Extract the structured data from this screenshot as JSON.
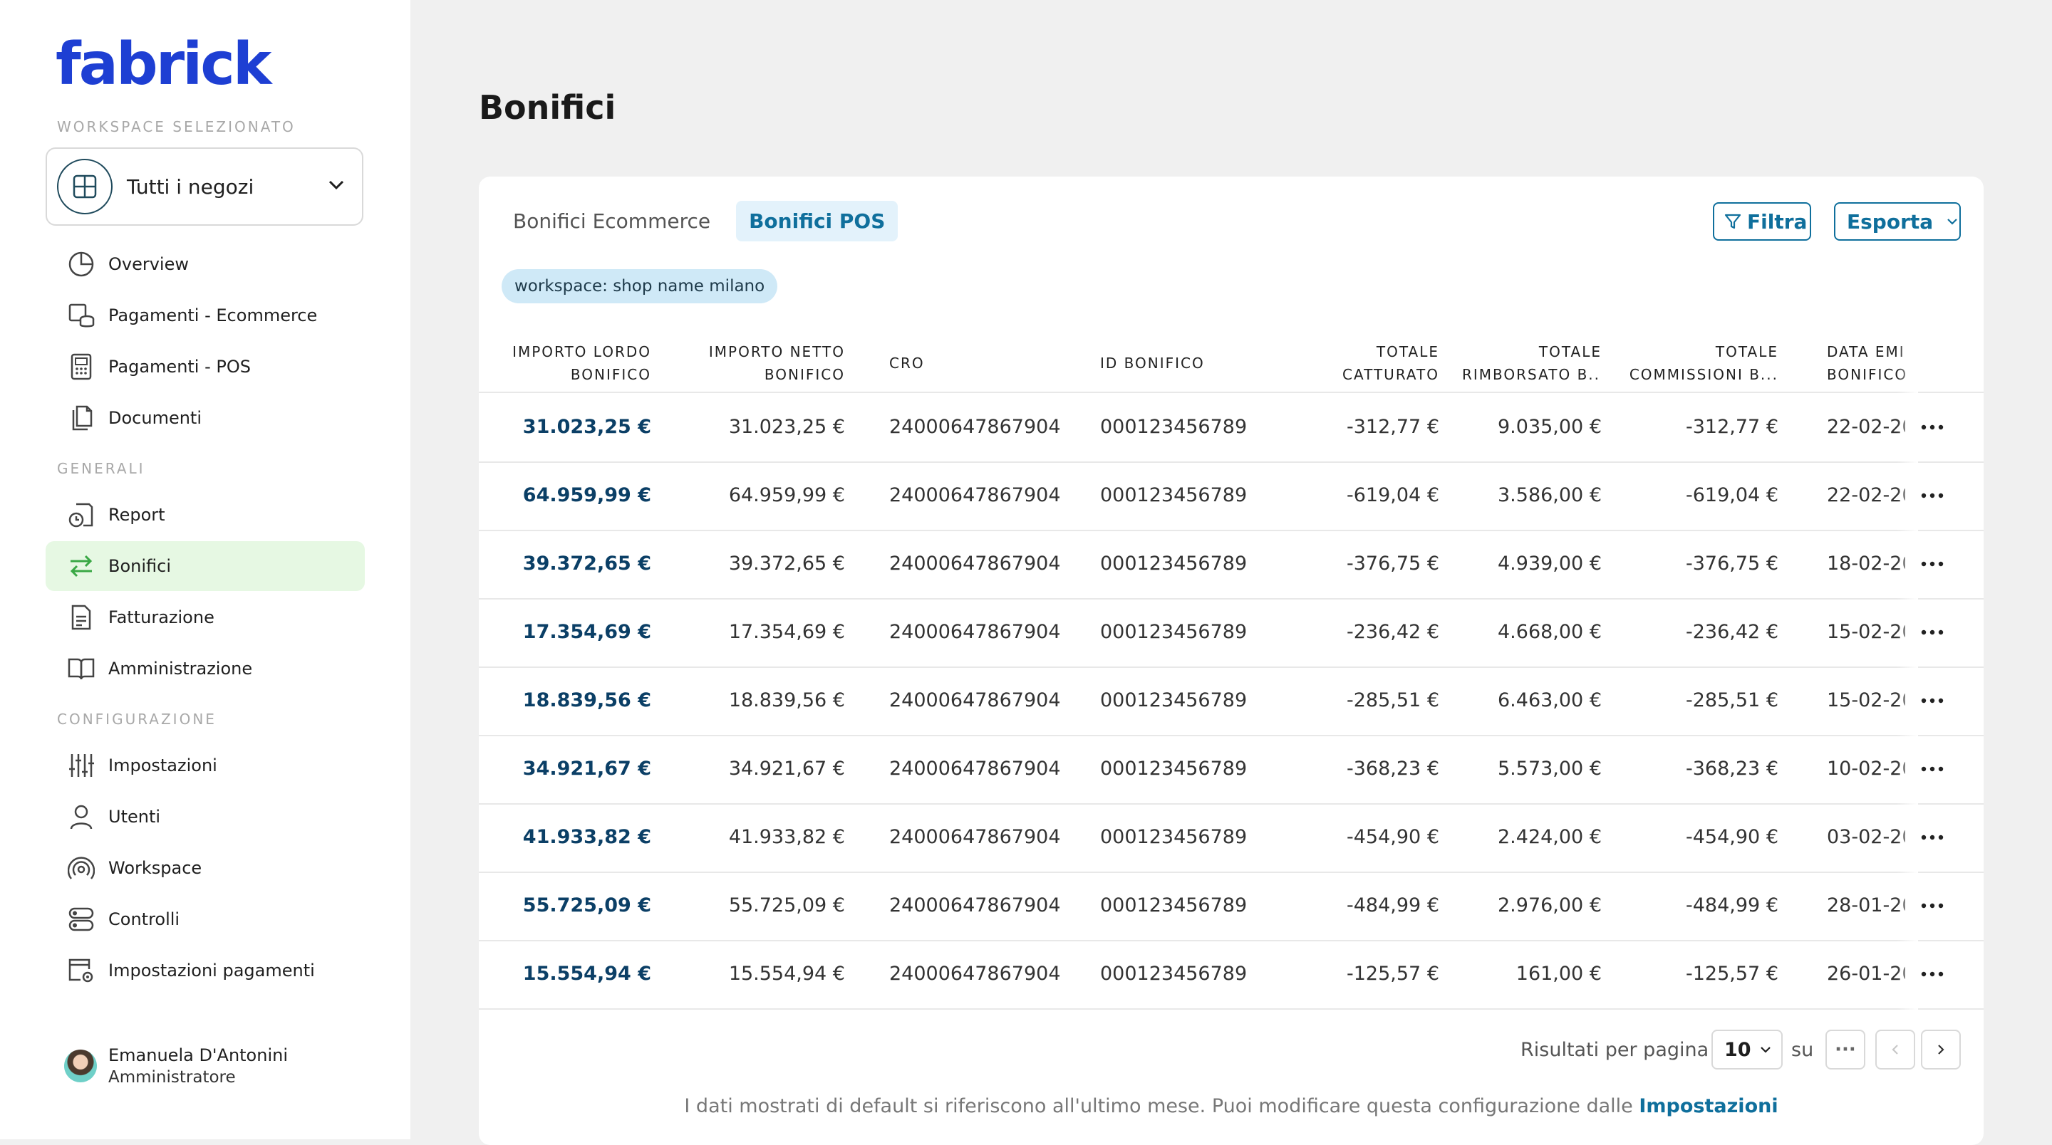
{
  "sidebar": {
    "logo": "fabrick",
    "workspace_section": "WORKSPACE SELEZIONATO",
    "workspace_value": "Tutti i negozi",
    "nav_top": [
      {
        "label": "Overview",
        "icon": "pie-chart-icon"
      },
      {
        "label": "Pagamenti - Ecommerce",
        "icon": "cart-coins-icon"
      },
      {
        "label": "Pagamenti - POS",
        "icon": "pos-terminal-icon"
      },
      {
        "label": "Documenti",
        "icon": "documents-icon"
      }
    ],
    "section_generali": "GENERALI",
    "nav_generali": [
      {
        "label": "Report",
        "icon": "report-clock-icon"
      },
      {
        "label": "Bonifici",
        "icon": "transfer-arrows-icon",
        "active": true
      },
      {
        "label": "Fatturazione",
        "icon": "invoice-icon"
      },
      {
        "label": "Amministrazione",
        "icon": "book-icon"
      }
    ],
    "section_config": "CONFIGURAZIONE",
    "nav_config": [
      {
        "label": "Impostazioni",
        "icon": "sliders-icon"
      },
      {
        "label": "Utenti",
        "icon": "user-icon"
      },
      {
        "label": "Workspace",
        "icon": "workspace-signal-icon"
      },
      {
        "label": "Controlli",
        "icon": "toggles-icon"
      },
      {
        "label": "Impostazioni pagamenti",
        "icon": "payment-settings-icon"
      }
    ],
    "user": {
      "name": "Emanuela D'Antonini",
      "role": "Amministratore"
    }
  },
  "main": {
    "title": "Bonifici",
    "tabs": [
      {
        "label": "Bonifici Ecommerce",
        "active": false
      },
      {
        "label": "Bonifici POS",
        "active": true
      }
    ],
    "filter_button": "Filtra",
    "export_button": "Esporta",
    "filter_chip": "workspace: shop name milano",
    "columns": [
      [
        "IMPORTO LORDO",
        "BONIFICO"
      ],
      [
        "IMPORTO NETTO",
        "BONIFICO"
      ],
      [
        "CRO"
      ],
      [
        "ID BONIFICO"
      ],
      [
        "TOTALE",
        "CATTURATO"
      ],
      [
        "TOTALE",
        "RIMBORSATO B..."
      ],
      [
        "TOTALE",
        "COMMISSIONI B..."
      ],
      [
        "DATA EMI",
        "BONIFICO"
      ]
    ],
    "rows": [
      [
        "31.023,25 €",
        "31.023,25 €",
        "24000647867904",
        "000123456789",
        "-312,77 €",
        "9.035,00 €",
        "-312,77 €",
        "22-02-20"
      ],
      [
        "64.959,99 €",
        "64.959,99 €",
        "24000647867904",
        "000123456789",
        "-619,04 €",
        "3.586,00 €",
        "-619,04 €",
        "22-02-20"
      ],
      [
        "39.372,65 €",
        "39.372,65 €",
        "24000647867904",
        "000123456789",
        "-376,75 €",
        "4.939,00 €",
        "-376,75 €",
        "18-02-20"
      ],
      [
        "17.354,69 €",
        "17.354,69 €",
        "24000647867904",
        "000123456789",
        "-236,42 €",
        "4.668,00 €",
        "-236,42 €",
        "15-02-20"
      ],
      [
        "18.839,56 €",
        "18.839,56 €",
        "24000647867904",
        "000123456789",
        "-285,51 €",
        "6.463,00 €",
        "-285,51 €",
        "15-02-20"
      ],
      [
        "34.921,67 €",
        "34.921,67 €",
        "24000647867904",
        "000123456789",
        "-368,23 €",
        "5.573,00 €",
        "-368,23 €",
        "10-02-20"
      ],
      [
        "41.933,82 €",
        "41.933,82 €",
        "24000647867904",
        "000123456789",
        "-454,90 €",
        "2.424,00 €",
        "-454,90 €",
        "03-02-20"
      ],
      [
        "55.725,09 €",
        "55.725,09 €",
        "24000647867904",
        "000123456789",
        "-484,99 €",
        "2.976,00 €",
        "-484,99 €",
        "28-01-20"
      ],
      [
        "15.554,94 €",
        "15.554,94 €",
        "24000647867904",
        "000123456789",
        "-125,57 €",
        "161,00 €",
        "-125,57 €",
        "26-01-20"
      ]
    ],
    "pagination": {
      "per_page_label": "Risultati per pagina",
      "per_page_value": "10",
      "of_label": "su",
      "total_placeholder": "···"
    },
    "footer_note": "I dati mostrati di default si riferiscono all'ultimo mese. Puoi modificare questa configurazione dalle",
    "footer_link": "Impostazioni"
  },
  "colors": {
    "brand": "#1e3fd3",
    "accent": "#0f6f9c",
    "active_nav": "#e6f8e3",
    "chip": "#cfe9f7"
  }
}
